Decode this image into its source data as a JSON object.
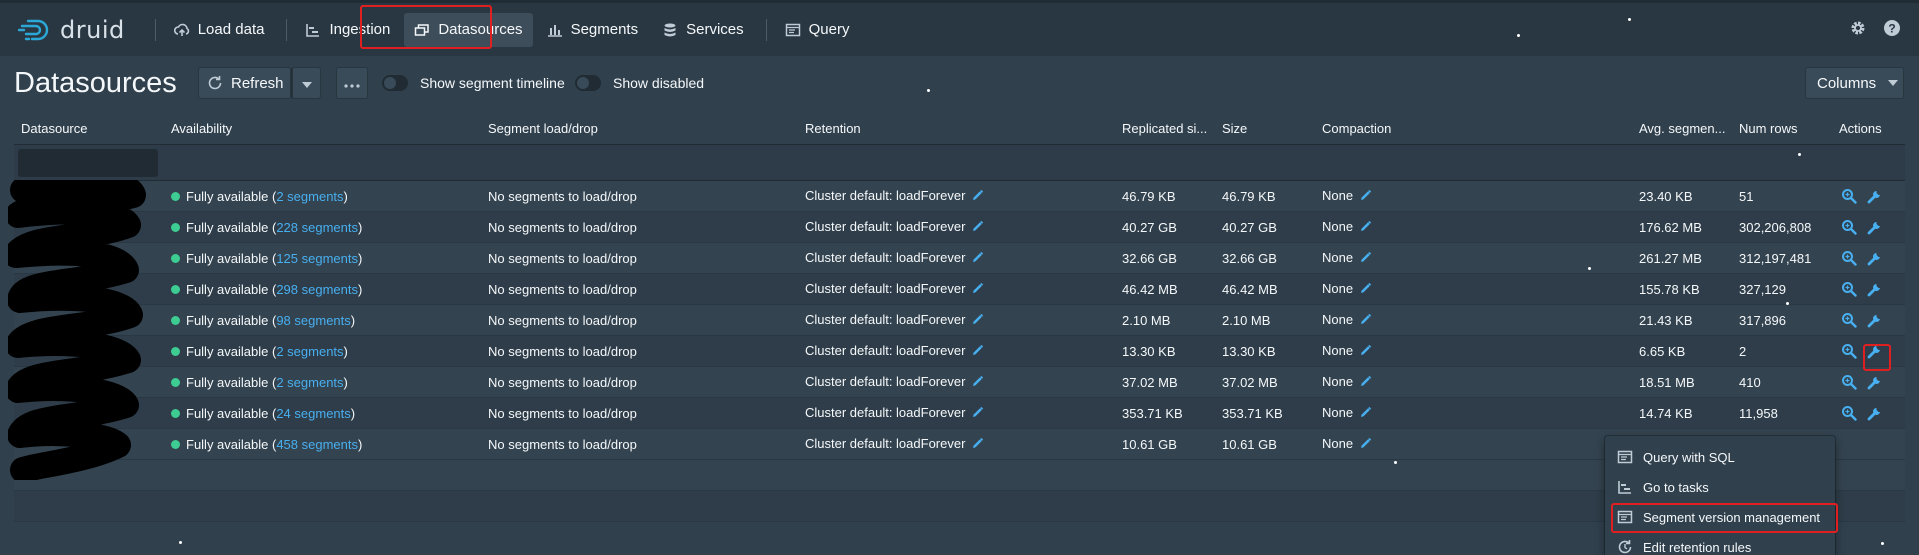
{
  "app": {
    "name": "druid"
  },
  "nav": {
    "items": [
      {
        "label": "Load data",
        "icon": "cloud-upload-icon"
      },
      {
        "label": "Ingestion",
        "icon": "gantt-chart-icon"
      },
      {
        "label": "Datasources",
        "icon": "multi-select-icon",
        "active": true
      },
      {
        "label": "Segments",
        "icon": "stacked-chart-icon"
      },
      {
        "label": "Services",
        "icon": "database-icon"
      },
      {
        "label": "Query",
        "icon": "application-icon"
      }
    ],
    "right_icons": [
      "gear-icon",
      "help-icon"
    ]
  },
  "header": {
    "title": "Datasources",
    "refresh_label": "Refresh",
    "show_segment_timeline": "Show segment timeline",
    "show_disabled": "Show disabled",
    "columns_label": "Columns"
  },
  "table": {
    "columns": [
      "Datasource",
      "Availability",
      "Segment load/drop",
      "Retention",
      "Replicated si...",
      "Size",
      "Compaction",
      "Avg. segmen...",
      "Num rows",
      "Actions"
    ],
    "rows": [
      {
        "avail_prefix": "Fully available (",
        "segments": "2 segments",
        "avail_suffix": ")",
        "load": "No segments to load/drop",
        "retention": "Cluster default: loadForever",
        "replicated": "46.79 KB",
        "size": "46.79 KB",
        "compaction": "None",
        "avg": "23.40 KB",
        "numrows": "51"
      },
      {
        "avail_prefix": "Fully available (",
        "segments": "228 segments",
        "avail_suffix": ")",
        "load": "No segments to load/drop",
        "retention": "Cluster default: loadForever",
        "replicated": "40.27 GB",
        "size": "40.27 GB",
        "compaction": "None",
        "avg": "176.62 MB",
        "numrows": "302,206,808"
      },
      {
        "avail_prefix": "Fully available (",
        "segments": "125 segments",
        "avail_suffix": ")",
        "load": "No segments to load/drop",
        "retention": "Cluster default: loadForever",
        "replicated": "32.66 GB",
        "size": "32.66 GB",
        "compaction": "None",
        "avg": "261.27 MB",
        "numrows": "312,197,481"
      },
      {
        "avail_prefix": "Fully available (",
        "segments": "298 segments",
        "avail_suffix": ")",
        "load": "No segments to load/drop",
        "retention": "Cluster default: loadForever",
        "replicated": "46.42 MB",
        "size": "46.42 MB",
        "compaction": "None",
        "avg": "155.78 KB",
        "numrows": "327,129"
      },
      {
        "avail_prefix": "Fully available (",
        "segments": "98 segments",
        "avail_suffix": ")",
        "load": "No segments to load/drop",
        "retention": "Cluster default: loadForever",
        "replicated": "2.10 MB",
        "size": "2.10 MB",
        "compaction": "None",
        "avg": "21.43 KB",
        "numrows": "317,896"
      },
      {
        "avail_prefix": "Fully available (",
        "segments": "2 segments",
        "avail_suffix": ")",
        "load": "No segments to load/drop",
        "retention": "Cluster default: loadForever",
        "replicated": "13.30 KB",
        "size": "13.30 KB",
        "compaction": "None",
        "avg": "6.65 KB",
        "numrows": "2"
      },
      {
        "avail_prefix": "Fully available (",
        "segments": "2 segments",
        "avail_suffix": ")",
        "load": "No segments to load/drop",
        "retention": "Cluster default: loadForever",
        "replicated": "37.02 MB",
        "size": "37.02 MB",
        "compaction": "None",
        "avg": "18.51 MB",
        "numrows": "410"
      },
      {
        "avail_prefix": "Fully available (",
        "segments": "24 segments",
        "avail_suffix": ")",
        "load": "No segments to load/drop",
        "retention": "Cluster default: loadForever",
        "replicated": "353.71 KB",
        "size": "353.71 KB",
        "compaction": "None",
        "avg": "14.74 KB",
        "numrows": "11,958"
      },
      {
        "avail_prefix": "Fully available (",
        "segments": "458 segments",
        "avail_suffix": ")",
        "load": "No segments to load/drop",
        "retention": "Cluster default: loadForever",
        "replicated": "10.61 GB",
        "size": "10.61 GB",
        "compaction": "None",
        "avg": "",
        "numrows": ""
      }
    ]
  },
  "actions_menu": {
    "items": [
      {
        "label": "Query with SQL",
        "icon": "application-icon"
      },
      {
        "label": "Go to tasks",
        "icon": "gantt-chart-icon"
      },
      {
        "label": "Segment version management",
        "icon": "application-icon"
      },
      {
        "label": "Edit retention rules",
        "icon": "automatic-updates-icon"
      }
    ]
  },
  "colors": {
    "accent_link": "#48aff0",
    "available_dot": "#3dcc91",
    "highlight": "#e02020"
  }
}
